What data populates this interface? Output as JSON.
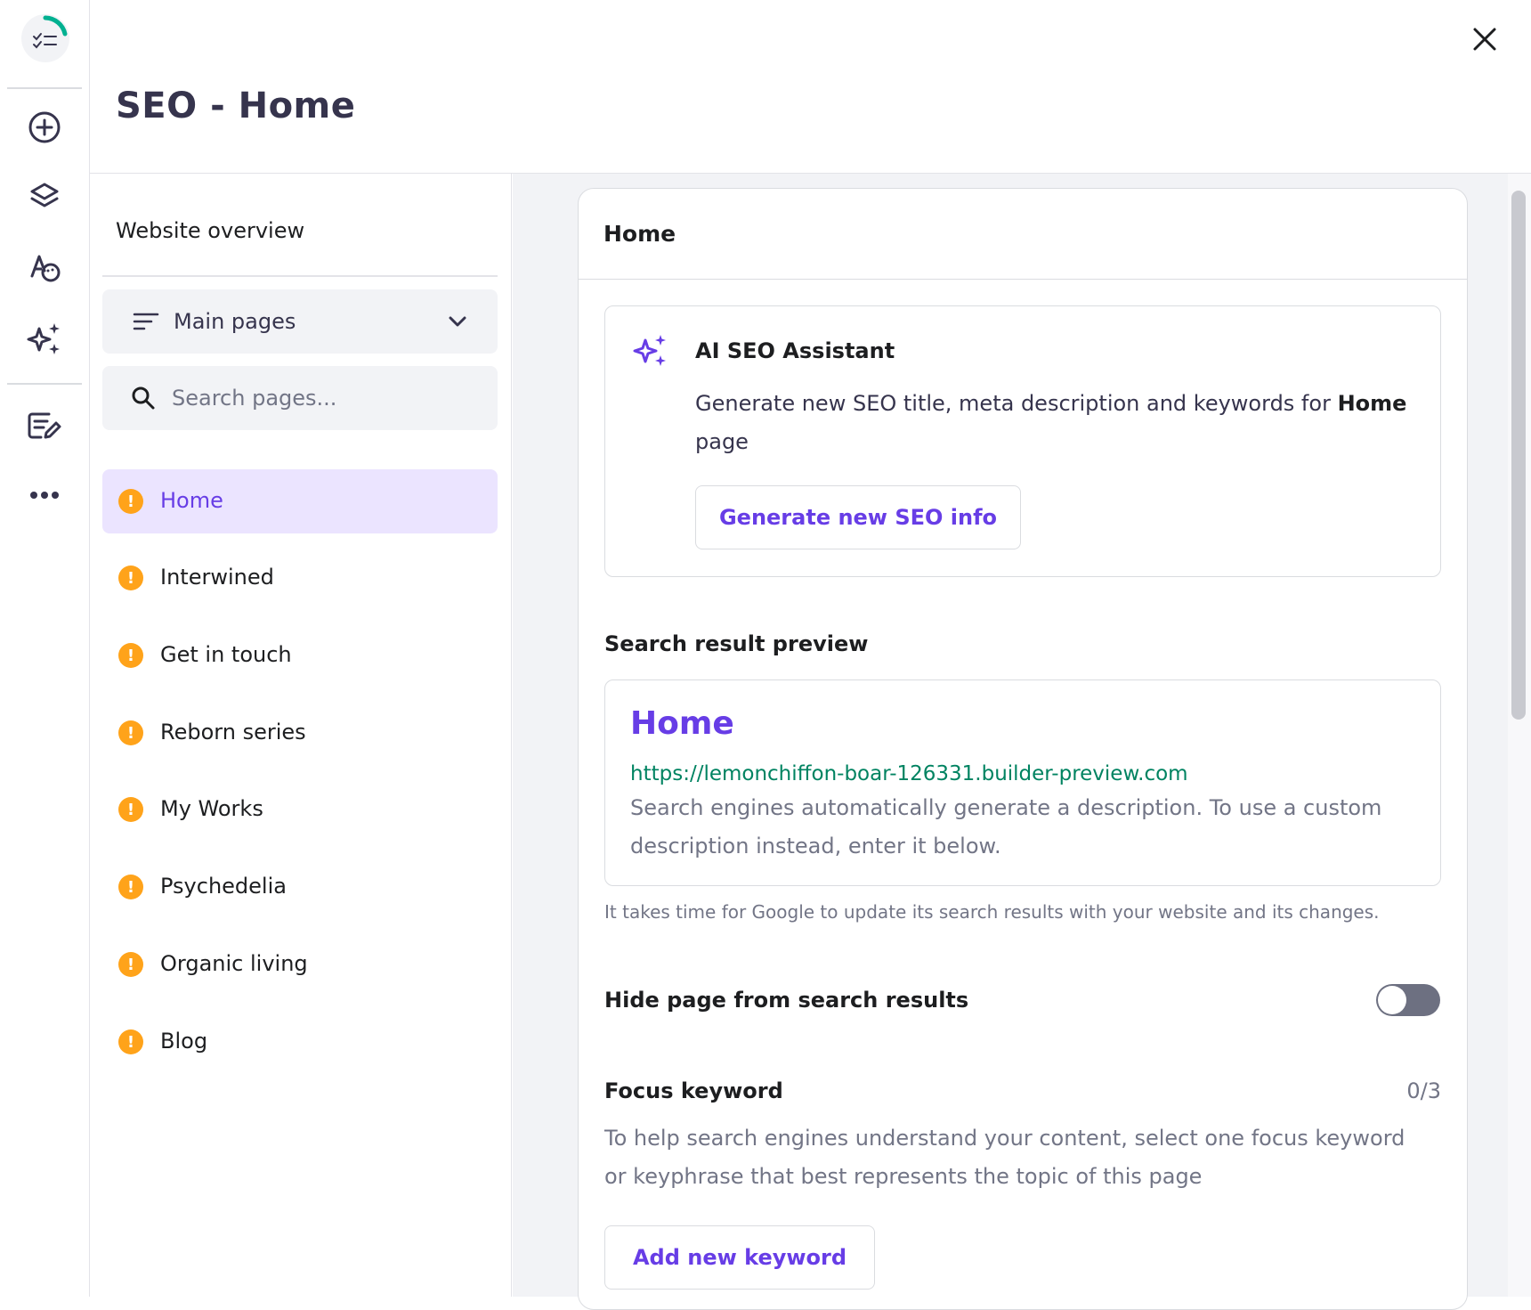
{
  "header": {
    "title": "SEO - Home"
  },
  "rail": {
    "items": [
      {
        "name": "add-icon"
      },
      {
        "name": "layers-icon"
      },
      {
        "name": "styles-icon"
      },
      {
        "name": "ai-tools-icon"
      },
      {
        "name": "blog-edit-icon"
      },
      {
        "name": "more-icon"
      }
    ]
  },
  "pages_panel": {
    "overview": "Website overview",
    "dropdown": {
      "selected": "Main pages"
    },
    "search": {
      "placeholder": "Search pages..."
    },
    "items": [
      {
        "label": "Home",
        "active": true
      },
      {
        "label": "Interwined"
      },
      {
        "label": "Get in touch"
      },
      {
        "label": "Reborn series"
      },
      {
        "label": "My Works"
      },
      {
        "label": "Psychedelia"
      },
      {
        "label": "Organic living"
      },
      {
        "label": "Blog"
      }
    ],
    "warning_symbol": "!"
  },
  "card": {
    "title": "Home",
    "ai": {
      "title": "AI SEO Assistant",
      "desc_prefix": "Generate new SEO title, meta description and keywords for ",
      "desc_bold": "Home",
      "desc_suffix": " page",
      "button": "Generate new SEO info"
    },
    "preview": {
      "section_title": "Search result preview",
      "title": "Home",
      "url": "https://lemonchiffon-boar-126331.builder-preview.com",
      "description": "Search engines automatically generate a description. To use a custom description instead, enter it below.",
      "note": "It takes time for Google to update its search results with your website and its changes."
    },
    "hide": {
      "label": "Hide page from search results",
      "enabled": false
    },
    "keyword": {
      "title": "Focus keyword",
      "counter": "0/3",
      "description": "To help search engines understand your content, select one focus keyword or keyphrase that best represents the topic of this page",
      "button": "Add new keyword"
    }
  },
  "colors": {
    "accent": "#673de6",
    "warning": "#ffa31a",
    "url_green": "#008361",
    "active_bg": "#ebe4ff"
  }
}
